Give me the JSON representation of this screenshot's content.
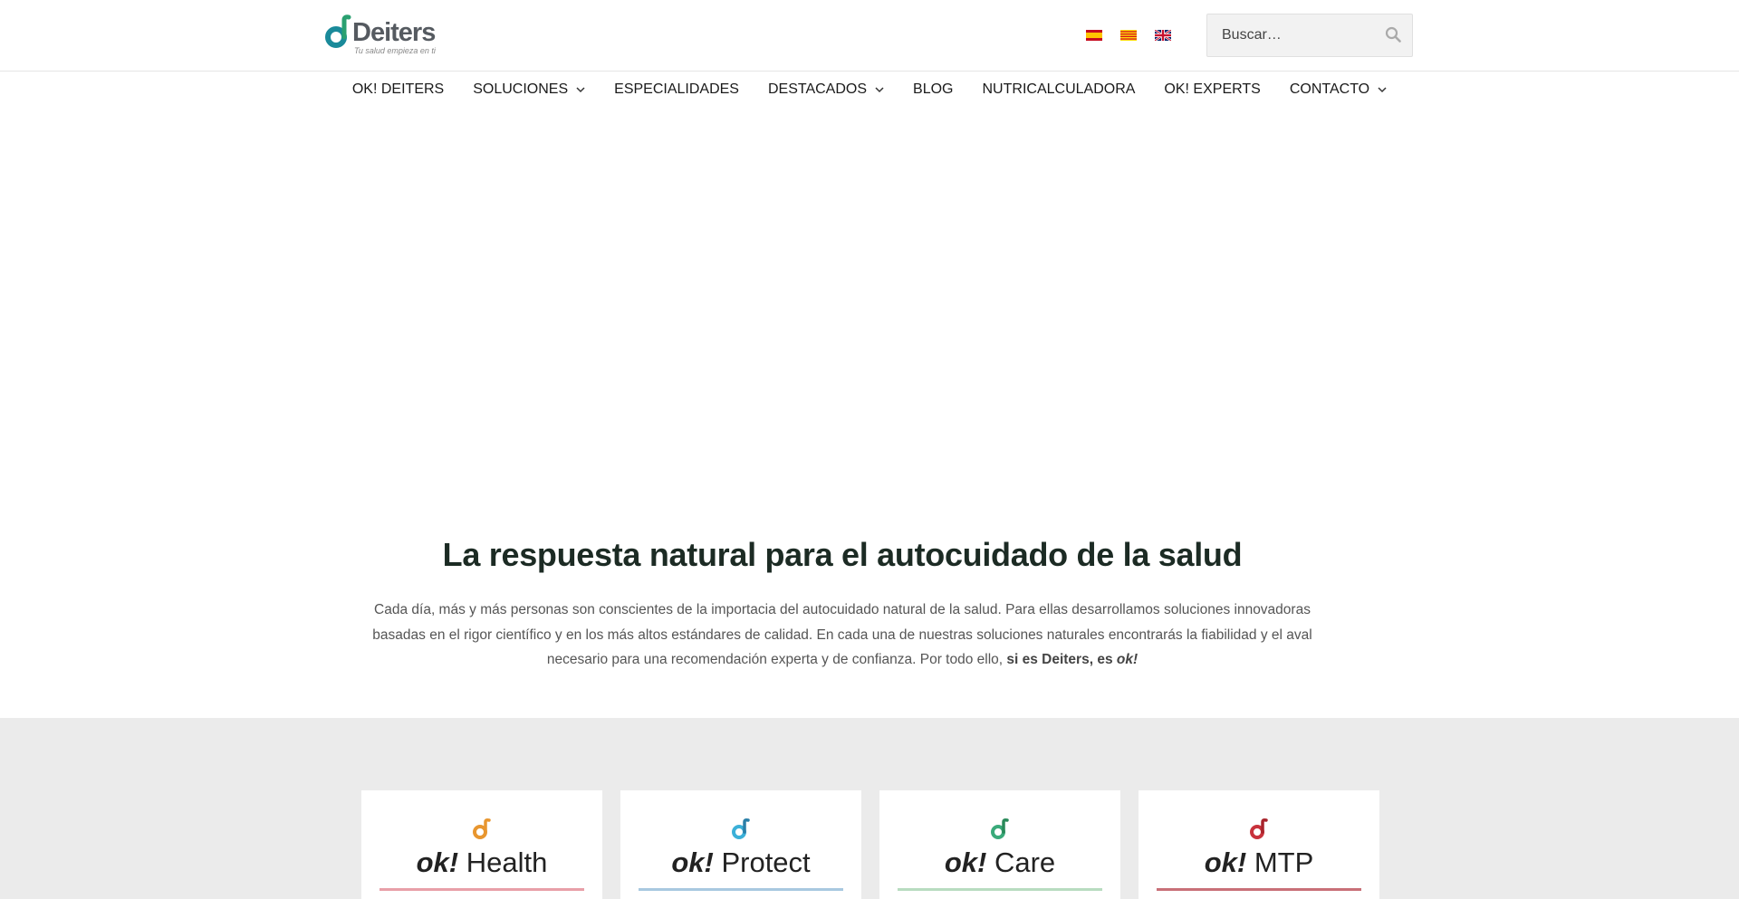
{
  "header": {
    "logo": {
      "word": "Deiters",
      "tagline": "Tu salud empieza en ti"
    },
    "languages": [
      {
        "name": "es-flag-icon"
      },
      {
        "name": "ca-flag-icon"
      },
      {
        "name": "en-flag-icon"
      }
    ],
    "search": {
      "placeholder": "Buscar…",
      "icon": "search-icon"
    }
  },
  "nav": {
    "items": [
      {
        "label": "OK! DEITERS",
        "dropdown": false
      },
      {
        "label": "SOLUCIONES",
        "dropdown": true
      },
      {
        "label": "ESPECIALIDADES",
        "dropdown": false
      },
      {
        "label": "DESTACADOS",
        "dropdown": true
      },
      {
        "label": "BLOG",
        "dropdown": false
      },
      {
        "label": "NUTRICALCULADORA",
        "dropdown": false
      },
      {
        "label": "OK! EXPERTS",
        "dropdown": false
      },
      {
        "label": "CONTACTO",
        "dropdown": true
      }
    ]
  },
  "hero": {
    "title": "La respuesta natural para el autocuidado de la salud",
    "text_1": "Cada día, más y más personas son conscientes de la importacia del autocuidado natural de la salud. Para ellas desarrollamos soluciones innovadoras basadas en el rigor científico y en los más altos estándares de calidad. En cada una de nuestras soluciones naturales encontrarás la fiabilidad y el aval necesario para una recomendación experta y de confianza. Por todo ello, ",
    "text_bold": "si es Deiters, es ",
    "text_bold_italic": "ok!"
  },
  "cards": [
    {
      "prefix": "ok!",
      "name": "Health",
      "color": "#e8962f",
      "line_color": "#e8a0a8"
    },
    {
      "prefix": "ok!",
      "name": "Protect",
      "color": "#3bb0d8",
      "line_color": "#a8c8e0"
    },
    {
      "prefix": "ok!",
      "name": "Care",
      "color": "#3aaa7a",
      "line_color": "#b8dcc0"
    },
    {
      "prefix": "ok!",
      "name": "MTP",
      "color": "#c8323c",
      "line_color": "#c87078"
    }
  ],
  "colors": {
    "brand_teal": "#1a8a9a",
    "brand_green": "#2aa070",
    "title": "#1c2b24",
    "band": "#ebebeb"
  }
}
